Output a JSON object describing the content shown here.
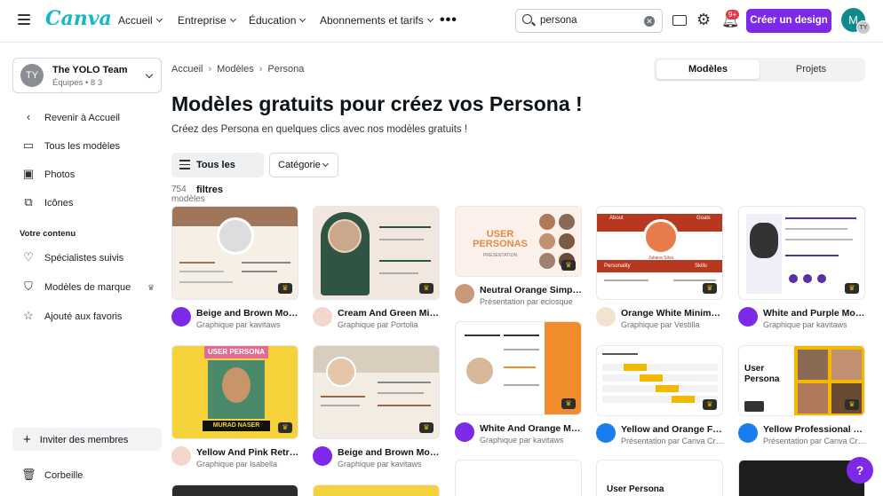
{
  "topbar": {
    "logo": "Canva",
    "nav": [
      "Accueil",
      "Entreprise",
      "Éducation",
      "Abonnements et tarifs"
    ],
    "more": "•••",
    "search_value": "persona",
    "notif_badge": "9+",
    "create_label": "Créer un design",
    "avatar_initial": "M",
    "avatar_team": "TY"
  },
  "sidebar": {
    "team_initials": "TY",
    "team_name": "The YOLO Team",
    "team_meta": "Équipes • 8 3",
    "items": [
      "Revenir à Accueil",
      "Tous les modèles",
      "Photos",
      "Icônes"
    ],
    "section_label": "Votre contenu",
    "content_items": [
      "Spécialistes suivis",
      "Modèles de marque",
      "Ajouté aux favoris"
    ],
    "invite_label": "Inviter des membres",
    "trash_label": "Corbeille"
  },
  "main": {
    "breadcrumb": [
      "Accueil",
      "Modèles",
      "Persona"
    ],
    "toggle": [
      "Modèles",
      "Projets"
    ],
    "title": "Modèles gratuits pour créez vos Persona !",
    "subtitle": "Créez des Persona en quelques clics avec nos modèles gratuits !",
    "filters_label": "Tous les filtres",
    "category_label": "Catégorie",
    "count": "754 modèles"
  },
  "cards": [
    {
      "title": "Beige and Brown Mode...",
      "sub": "Graphique par kavitaws",
      "colors": [
        "#f5efe6",
        "#a0765a"
      ],
      "avatar_color": "#7d2ae8"
    },
    {
      "title": "Cream And Green Mini...",
      "sub": "Graphique par Portolia",
      "colors": [
        "#f1e7df",
        "#2f5443"
      ],
      "avatar_color": "#f3d6cc"
    },
    {
      "title": "Neutral Orange Simple...",
      "sub": "Présentation par eclosque",
      "colors": [
        "#fbf1ea",
        "#e88a43"
      ],
      "avatar_color": "#c89a7a"
    },
    {
      "title": "Orange White Minimali...",
      "sub": "Graphique par Vestilla",
      "colors": [
        "#ffffff",
        "#b8371f"
      ],
      "avatar_color": "#f2e3d1"
    },
    {
      "title": "White and Purple Mod...",
      "sub": "Graphique par kavitaws",
      "colors": [
        "#ffffff",
        "#5a2ea6"
      ],
      "avatar_color": "#7d2ae8"
    },
    {
      "title": "Yellow And Pink Retro ...",
      "sub": "Graphique par Isabella",
      "colors": [
        "#f6d23a",
        "#e26b94"
      ],
      "avatar_color": "#f3d6cc"
    },
    {
      "title": "Beige and Brown Mode...",
      "sub": "Graphique par kavitaws",
      "colors": [
        "#f3ece2",
        "#9a6a47"
      ],
      "avatar_color": "#7d2ae8"
    },
    {
      "title": "White And Orange Mo...",
      "sub": "Graphique par kavitaws",
      "colors": [
        "#ffffff",
        "#f08c2a"
      ],
      "avatar_color": "#7d2ae8"
    },
    {
      "title": "Yellow and Orange Fou...",
      "sub": "Présentation par Canva Cre...",
      "colors": [
        "#ffffff",
        "#f5b800"
      ],
      "avatar_color": "#1a7cf0"
    },
    {
      "title": "Yellow Professional Gr...",
      "sub": "Présentation par Canva Cre...",
      "colors": [
        "#ffffff",
        "#f5b800"
      ],
      "avatar_color": "#1a7cf0"
    }
  ],
  "thumb_texts": {
    "user_personas": "USER PERSONAS",
    "presentation": "PRESENTATION",
    "user_persona": "USER PERSONA",
    "murad": "MURAD NASER",
    "user_persona_2": "User Persona",
    "user_persona_3": "User Persona",
    "juliana": "Juliana Silva",
    "about": "About",
    "goals": "Goals",
    "personality": "Personality",
    "skills": "Skills"
  },
  "help": "?"
}
